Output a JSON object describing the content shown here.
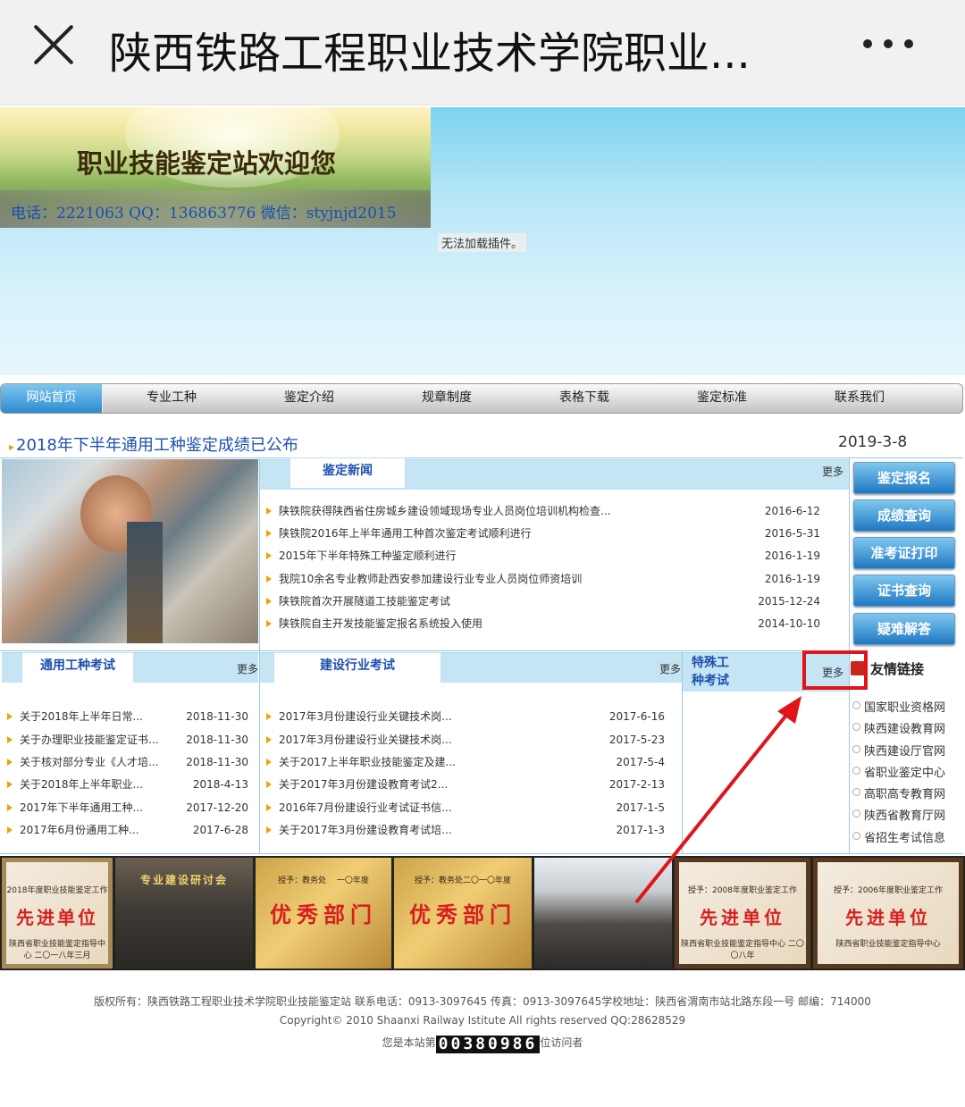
{
  "header": {
    "title": "陕西铁路工程职业技术学院职业..."
  },
  "banner": {
    "title": "职业技能鉴定站欢迎您",
    "contact": "电话：2221063   QQ：136863776   微信：styjnjd2015",
    "plugin_note": "无法加载插件。"
  },
  "nav": [
    "网站首页",
    "专业工种",
    "鉴定介绍",
    "规章制度",
    "表格下载",
    "鉴定标准",
    "联系我们"
  ],
  "headline": {
    "text": "2018年下半年通用工种鉴定成绩已公布",
    "date": "2019-3-8"
  },
  "news": {
    "title": "鉴定新闻",
    "more": "更多",
    "items": [
      {
        "text": "陕铁院获得陕西省住房城乡建设领域现场专业人员岗位培训机构检查...",
        "date": "2016-6-12"
      },
      {
        "text": "陕铁院2016年上半年通用工种首次鉴定考试顺利进行",
        "date": "2016-5-31"
      },
      {
        "text": "2015年下半年特殊工种鉴定顺利进行",
        "date": "2016-1-19"
      },
      {
        "text": "我院10余名专业教师赴西安参加建设行业专业人员岗位师资培训",
        "date": "2016-1-19"
      },
      {
        "text": "陕铁院首次开展隧道工技能鉴定考试",
        "date": "2015-12-24"
      },
      {
        "text": "陕铁院自主开发技能鉴定报名系统投入使用",
        "date": "2014-10-10"
      }
    ]
  },
  "quick_buttons": [
    "鉴定报名",
    "成绩查询",
    "准考证打印",
    "证书查询",
    "疑难解答"
  ],
  "general_exam": {
    "title": "通用工种考试",
    "more": "更多",
    "items": [
      {
        "text": "关于2018年上半年日常...",
        "date": "2018-11-30"
      },
      {
        "text": "关于办理职业技能鉴定证书...",
        "date": "2018-11-30"
      },
      {
        "text": "关于核对部分专业《人才培...",
        "date": "2018-11-30"
      },
      {
        "text": "关于2018年上半年职业...",
        "date": "2018-4-13"
      },
      {
        "text": "2017年下半年通用工种...",
        "date": "2017-12-20"
      },
      {
        "text": "2017年6月份通用工种...",
        "date": "2017-6-28"
      }
    ]
  },
  "construction_exam": {
    "title": "建设行业考试",
    "more": "更多",
    "items": [
      {
        "text": "2017年3月份建设行业关键技术岗...",
        "date": "2017-6-16"
      },
      {
        "text": "2017年3月份建设行业关键技术岗...",
        "date": "2017-5-23"
      },
      {
        "text": "关于2017上半年职业技能鉴定及建...",
        "date": "2017-5-4"
      },
      {
        "text": "关于2017年3月份建设教育考试2...",
        "date": "2017-2-13"
      },
      {
        "text": "2016年7月份建设行业考试证书信...",
        "date": "2017-1-5"
      },
      {
        "text": "关于2017年3月份建设教育考试培...",
        "date": "2017-1-3"
      }
    ]
  },
  "special_exam": {
    "title_line1": "特殊工",
    "title_line2": "种考试",
    "more": "更多"
  },
  "friend_links": {
    "title": "友情链接",
    "items": [
      "国家职业资格网",
      "陕西建设教育网",
      "陕西建设厅官网",
      "省职业鉴定中心",
      "高职高专教育网",
      "陕西省教育厅网",
      "省招生考试信息"
    ]
  },
  "gallery": [
    {
      "kind": "plaque",
      "big": "先进单位",
      "top": "2018年度职业技能鉴定工作",
      "bottom": "陕西省职业技能鉴定指导中心 二〇一八年三月"
    },
    {
      "kind": "photo",
      "big": "专业建设研讨会"
    },
    {
      "kind": "gold",
      "big": "优秀部门",
      "top": "授予：教务处 　一〇年度"
    },
    {
      "kind": "gold",
      "big": "优秀部门",
      "top": "授予：教务处二〇一〇年度"
    },
    {
      "kind": "photo",
      "big": ""
    },
    {
      "kind": "plaque",
      "big": "先进单位",
      "top": "授予：2008年度职业鉴定工作",
      "bottom": "陕西省职业技能鉴定指导中心 二〇〇八年"
    },
    {
      "kind": "plaque",
      "big": "先进单位",
      "top": "授予：2006年度职业鉴定工作",
      "bottom": "陕西省职业技能鉴定指导中心"
    }
  ],
  "footer": {
    "copyright": "版权所有：陕西铁路工程职业技术学院职业技能鉴定站 联系电话：0913-3097645 传真：0913-3097645学校地址：陕西省渭南市站北路东段一号 邮编：714000",
    "copyright_en": "Copyright© 2010 Shaanxi Railway Istitute All rights reserved QQ:28628529",
    "visitor_prefix": "您是本站第",
    "visitor_count": "00380986",
    "visitor_suffix": "位访问者"
  },
  "colors": {
    "highlight": "#e0151b",
    "link_blue": "#1e50b0",
    "nav_active": "#2d8cd0"
  }
}
